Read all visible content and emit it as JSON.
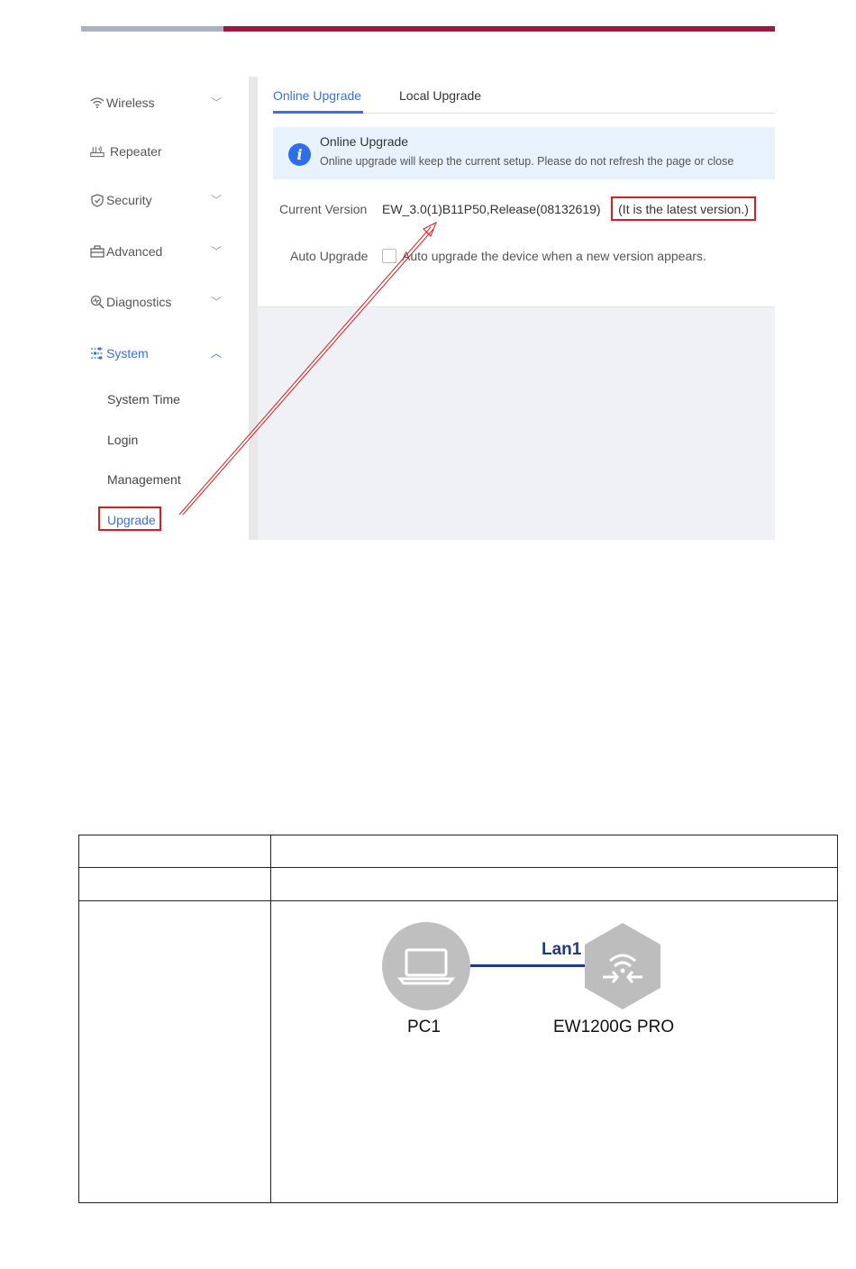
{
  "sidebar": {
    "items": [
      {
        "label": "Wireless",
        "icon": "wifi-icon",
        "expanded": false
      },
      {
        "label": "Repeater",
        "icon": "repeater-icon"
      },
      {
        "label": "Security",
        "icon": "shield-icon",
        "expanded": false
      },
      {
        "label": "Advanced",
        "icon": "toolbox-icon",
        "expanded": false
      },
      {
        "label": "Diagnostics",
        "icon": "diagnostics-icon",
        "expanded": false
      },
      {
        "label": "System",
        "icon": "system-icon",
        "expanded": true
      }
    ],
    "subitems": [
      "System Time",
      "Login",
      "Management",
      "Upgrade"
    ],
    "active_subitem": "Upgrade"
  },
  "tabs": [
    {
      "label": "Online Upgrade",
      "active": true
    },
    {
      "label": "Local Upgrade",
      "active": false
    }
  ],
  "info": {
    "title": "Online Upgrade",
    "text": "Online upgrade will keep the current setup. Please do not refresh the page or close"
  },
  "current_version": {
    "label": "Current Version",
    "value": "EW_3.0(1)B11P50,Release(08132619)",
    "status": "(It is the latest version.)"
  },
  "auto_upgrade": {
    "label": "Auto Upgrade",
    "checked": false,
    "text": "Auto upgrade the device when a new version appears."
  },
  "topology": {
    "link_label": "Lan1",
    "pc_label": "PC1",
    "device_label": "EW1200G PRO"
  },
  "colors": {
    "accent": "#3b6fe0",
    "highlight": "#e0191f",
    "brand_bar": "#9a1b3f",
    "link": "#1f3a8a"
  }
}
